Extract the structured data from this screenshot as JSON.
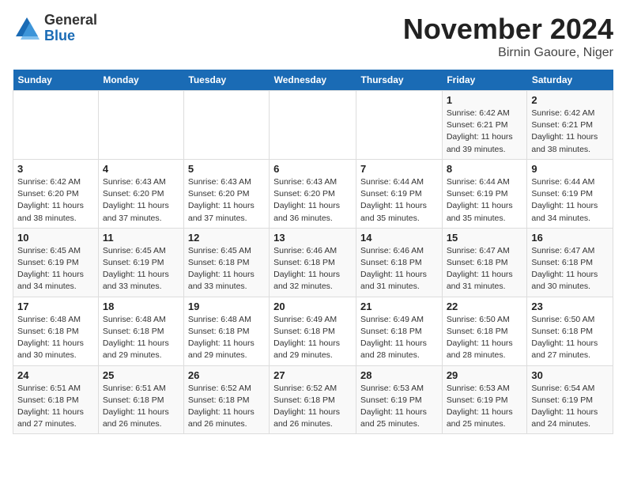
{
  "header": {
    "logo_general": "General",
    "logo_blue": "Blue",
    "month_title": "November 2024",
    "subtitle": "Birnin Gaoure, Niger"
  },
  "days_of_week": [
    "Sunday",
    "Monday",
    "Tuesday",
    "Wednesday",
    "Thursday",
    "Friday",
    "Saturday"
  ],
  "weeks": [
    [
      {
        "day": "",
        "info": ""
      },
      {
        "day": "",
        "info": ""
      },
      {
        "day": "",
        "info": ""
      },
      {
        "day": "",
        "info": ""
      },
      {
        "day": "",
        "info": ""
      },
      {
        "day": "1",
        "info": "Sunrise: 6:42 AM\nSunset: 6:21 PM\nDaylight: 11 hours and 39 minutes."
      },
      {
        "day": "2",
        "info": "Sunrise: 6:42 AM\nSunset: 6:21 PM\nDaylight: 11 hours and 38 minutes."
      }
    ],
    [
      {
        "day": "3",
        "info": "Sunrise: 6:42 AM\nSunset: 6:20 PM\nDaylight: 11 hours and 38 minutes."
      },
      {
        "day": "4",
        "info": "Sunrise: 6:43 AM\nSunset: 6:20 PM\nDaylight: 11 hours and 37 minutes."
      },
      {
        "day": "5",
        "info": "Sunrise: 6:43 AM\nSunset: 6:20 PM\nDaylight: 11 hours and 37 minutes."
      },
      {
        "day": "6",
        "info": "Sunrise: 6:43 AM\nSunset: 6:20 PM\nDaylight: 11 hours and 36 minutes."
      },
      {
        "day": "7",
        "info": "Sunrise: 6:44 AM\nSunset: 6:19 PM\nDaylight: 11 hours and 35 minutes."
      },
      {
        "day": "8",
        "info": "Sunrise: 6:44 AM\nSunset: 6:19 PM\nDaylight: 11 hours and 35 minutes."
      },
      {
        "day": "9",
        "info": "Sunrise: 6:44 AM\nSunset: 6:19 PM\nDaylight: 11 hours and 34 minutes."
      }
    ],
    [
      {
        "day": "10",
        "info": "Sunrise: 6:45 AM\nSunset: 6:19 PM\nDaylight: 11 hours and 34 minutes."
      },
      {
        "day": "11",
        "info": "Sunrise: 6:45 AM\nSunset: 6:19 PM\nDaylight: 11 hours and 33 minutes."
      },
      {
        "day": "12",
        "info": "Sunrise: 6:45 AM\nSunset: 6:18 PM\nDaylight: 11 hours and 33 minutes."
      },
      {
        "day": "13",
        "info": "Sunrise: 6:46 AM\nSunset: 6:18 PM\nDaylight: 11 hours and 32 minutes."
      },
      {
        "day": "14",
        "info": "Sunrise: 6:46 AM\nSunset: 6:18 PM\nDaylight: 11 hours and 31 minutes."
      },
      {
        "day": "15",
        "info": "Sunrise: 6:47 AM\nSunset: 6:18 PM\nDaylight: 11 hours and 31 minutes."
      },
      {
        "day": "16",
        "info": "Sunrise: 6:47 AM\nSunset: 6:18 PM\nDaylight: 11 hours and 30 minutes."
      }
    ],
    [
      {
        "day": "17",
        "info": "Sunrise: 6:48 AM\nSunset: 6:18 PM\nDaylight: 11 hours and 30 minutes."
      },
      {
        "day": "18",
        "info": "Sunrise: 6:48 AM\nSunset: 6:18 PM\nDaylight: 11 hours and 29 minutes."
      },
      {
        "day": "19",
        "info": "Sunrise: 6:48 AM\nSunset: 6:18 PM\nDaylight: 11 hours and 29 minutes."
      },
      {
        "day": "20",
        "info": "Sunrise: 6:49 AM\nSunset: 6:18 PM\nDaylight: 11 hours and 29 minutes."
      },
      {
        "day": "21",
        "info": "Sunrise: 6:49 AM\nSunset: 6:18 PM\nDaylight: 11 hours and 28 minutes."
      },
      {
        "day": "22",
        "info": "Sunrise: 6:50 AM\nSunset: 6:18 PM\nDaylight: 11 hours and 28 minutes."
      },
      {
        "day": "23",
        "info": "Sunrise: 6:50 AM\nSunset: 6:18 PM\nDaylight: 11 hours and 27 minutes."
      }
    ],
    [
      {
        "day": "24",
        "info": "Sunrise: 6:51 AM\nSunset: 6:18 PM\nDaylight: 11 hours and 27 minutes."
      },
      {
        "day": "25",
        "info": "Sunrise: 6:51 AM\nSunset: 6:18 PM\nDaylight: 11 hours and 26 minutes."
      },
      {
        "day": "26",
        "info": "Sunrise: 6:52 AM\nSunset: 6:18 PM\nDaylight: 11 hours and 26 minutes."
      },
      {
        "day": "27",
        "info": "Sunrise: 6:52 AM\nSunset: 6:18 PM\nDaylight: 11 hours and 26 minutes."
      },
      {
        "day": "28",
        "info": "Sunrise: 6:53 AM\nSunset: 6:19 PM\nDaylight: 11 hours and 25 minutes."
      },
      {
        "day": "29",
        "info": "Sunrise: 6:53 AM\nSunset: 6:19 PM\nDaylight: 11 hours and 25 minutes."
      },
      {
        "day": "30",
        "info": "Sunrise: 6:54 AM\nSunset: 6:19 PM\nDaylight: 11 hours and 24 minutes."
      }
    ]
  ]
}
